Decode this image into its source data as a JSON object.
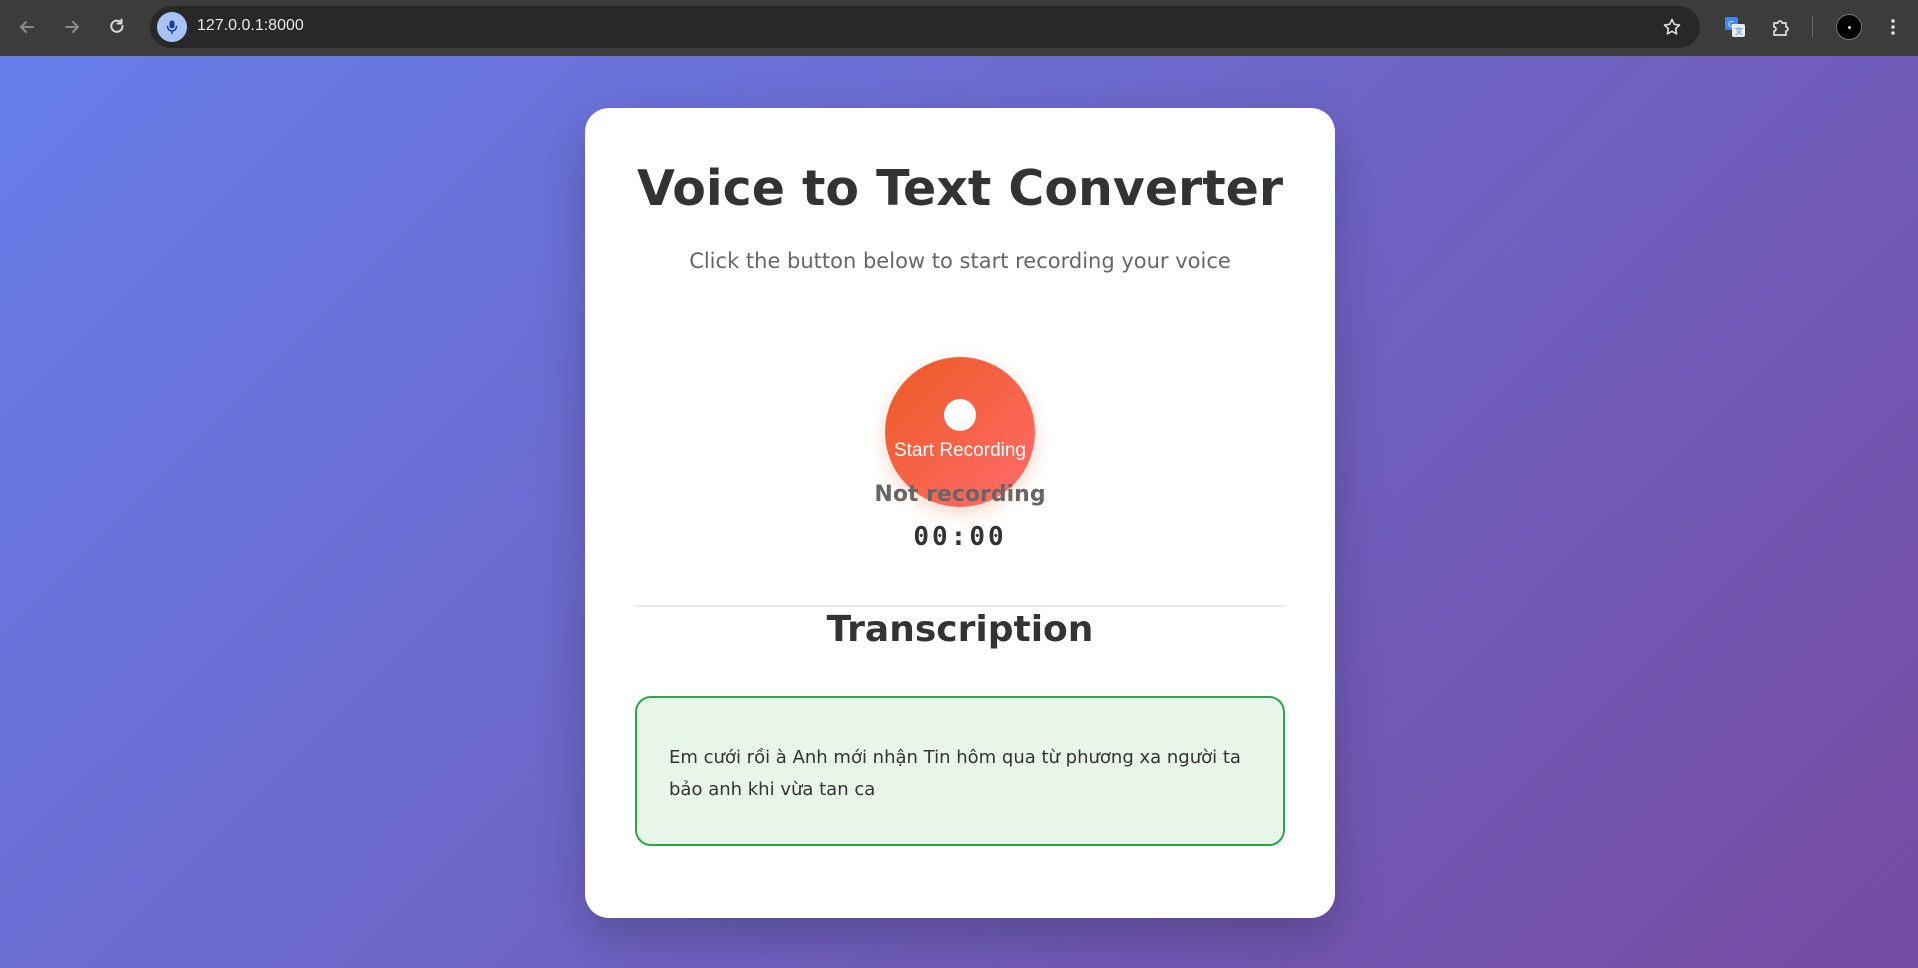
{
  "browser": {
    "url": "127.0.0.1:8000",
    "icons": {
      "back": "arrow-left-icon",
      "forward": "arrow-right-icon",
      "reload": "reload-icon",
      "site": "microphone-icon",
      "bookmark": "star-icon",
      "translate": "translate-icon",
      "extensions": "puzzle-icon",
      "menu": "kebab-menu-icon"
    }
  },
  "app": {
    "title": "Voice to Text Converter",
    "subtitle": "Click the button below to start recording your voice",
    "record_button_label": "Start Recording",
    "status": "Not recording",
    "timer": "00:00",
    "transcription_heading": "Transcription",
    "transcription_text": "Em cưới rồi à Anh mới nhận Tin hôm qua từ phương xa người ta bảo anh khi vừa tan ca"
  },
  "colors": {
    "background_gradient_start": "#667eea",
    "background_gradient_end": "#764ba2",
    "record_button_start": "#ee5a24",
    "record_button_end": "#ff6b6b",
    "transcript_border": "#28a745",
    "transcript_background": "#e8f5e9"
  }
}
